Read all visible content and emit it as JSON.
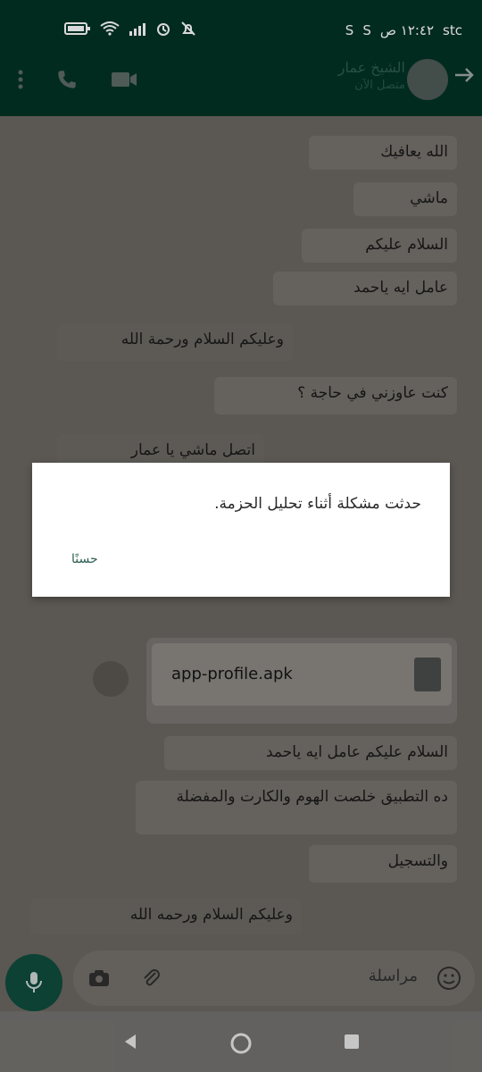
{
  "status_bar": {
    "carrier": "stc",
    "time": "١٢:٤٢ ص",
    "sim_badges": [
      "S",
      "S"
    ]
  },
  "header": {
    "contact_name": "الشيخ عمار",
    "contact_status": "متصل الآن"
  },
  "messages": [
    "الله يعافيك",
    "ماشي",
    "السلام عليكم",
    "عامل ايه ياحمد",
    "وعليكم السلام ورحمة الله",
    "كنت عاوزني في حاجة ؟",
    "اتصل ماشي يا عمار",
    "السلام عليكم عامل ايه ياحمد",
    "ده التطبيق خلصت الهوم والكارت والمفضلة",
    "والتسجيل",
    "وعليكم السلام ورحمه الله"
  ],
  "file": {
    "name": "app-profile.apk"
  },
  "dialog": {
    "message": "حدثت مشكلة أثناء تحليل الحزمة.",
    "ok_label": "حسنًا"
  },
  "input": {
    "placeholder": "مراسلة"
  },
  "icons": {
    "video_call": "video-icon",
    "voice_call": "phone-icon",
    "menu": "more-vert-icon",
    "back": "arrow-back-icon",
    "emoji": "emoji-icon",
    "attach": "paperclip-icon",
    "camera": "camera-icon",
    "mic": "mic-icon",
    "nav_back": "nav-back-icon",
    "nav_home": "nav-home-icon",
    "nav_recent": "nav-recent-icon"
  },
  "colors": {
    "header_bg": "#033326",
    "accent": "#0f4d3e",
    "dialog_bg": "#ffffff"
  }
}
